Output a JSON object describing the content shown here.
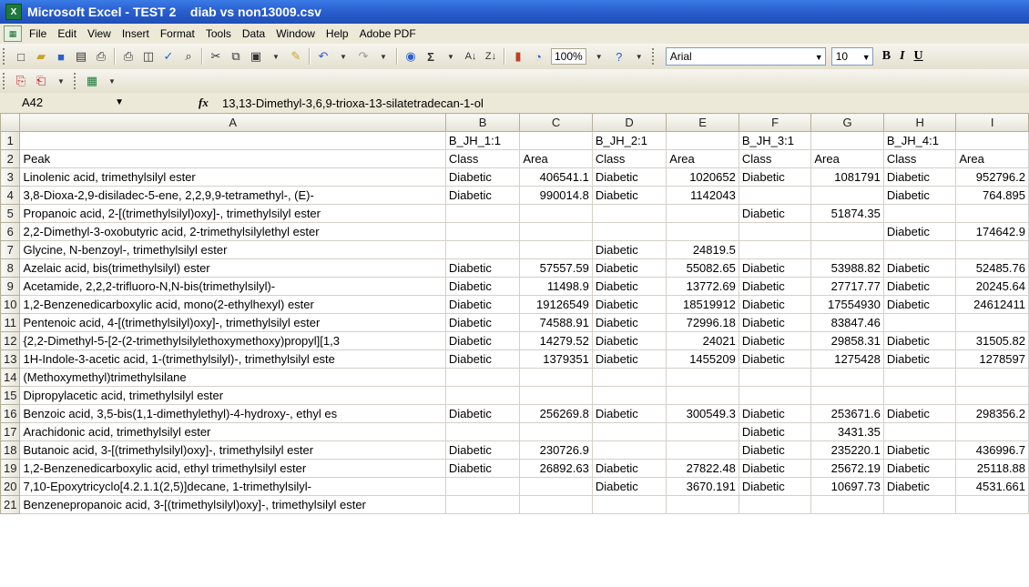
{
  "window": {
    "title": "Microsoft Excel - TEST 2    diab vs non13009.csv",
    "app_icon": "excel-icon"
  },
  "menu": [
    "File",
    "Edit",
    "View",
    "Insert",
    "Format",
    "Tools",
    "Data",
    "Window",
    "Help",
    "Adobe PDF"
  ],
  "toolbar": {
    "zoom": "100%",
    "font": "Arial",
    "size": "10",
    "bold": "B",
    "italic": "I",
    "underline": "U"
  },
  "formula_bar": {
    "name_box": "A42",
    "fx": "fx",
    "formula": "13,13-Dimethyl-3,6,9-trioxa-13-silatetradecan-1-ol"
  },
  "columns": [
    "A",
    "B",
    "C",
    "D",
    "E",
    "F",
    "G",
    "H",
    "I"
  ],
  "rows": [
    {
      "n": "1",
      "cells": [
        "",
        "B_JH_1:1",
        "",
        "B_JH_2:1",
        "",
        "B_JH_3:1",
        "",
        "B_JH_4:1",
        ""
      ]
    },
    {
      "n": "2",
      "cells": [
        "Peak",
        "Class",
        "Area",
        "Class",
        "Area",
        "Class",
        "Area",
        "Class",
        "Area"
      ]
    },
    {
      "n": "3",
      "cells": [
        "Linolenic acid, trimethylsilyl ester",
        "Diabetic",
        "406541.1",
        "Diabetic",
        "1020652",
        "Diabetic",
        "1081791",
        "Diabetic",
        "952796.2"
      ]
    },
    {
      "n": "4",
      "cells": [
        "3,8-Dioxa-2,9-disiladec-5-ene, 2,2,9,9-tetramethyl-, (E)-",
        "Diabetic",
        "990014.8",
        "Diabetic",
        "1142043",
        "",
        "",
        "Diabetic",
        "764.895"
      ]
    },
    {
      "n": "5",
      "cells": [
        "Propanoic acid, 2-[(trimethylsilyl)oxy]-, trimethylsilyl ester",
        "",
        "",
        "",
        "",
        "Diabetic",
        "51874.35",
        "",
        ""
      ]
    },
    {
      "n": "6",
      "cells": [
        "2,2-Dimethyl-3-oxobutyric acid, 2-trimethylsilylethyl ester",
        "",
        "",
        "",
        "",
        "",
        "",
        "Diabetic",
        "174642.9"
      ]
    },
    {
      "n": "7",
      "cells": [
        "Glycine, N-benzoyl-, trimethylsilyl ester",
        "",
        "",
        "Diabetic",
        "24819.5",
        "",
        "",
        "",
        ""
      ]
    },
    {
      "n": "8",
      "cells": [
        "Azelaic acid, bis(trimethylsilyl) ester",
        "Diabetic",
        "57557.59",
        "Diabetic",
        "55082.65",
        "Diabetic",
        "53988.82",
        "Diabetic",
        "52485.76"
      ]
    },
    {
      "n": "9",
      "cells": [
        "Acetamide, 2,2,2-trifluoro-N,N-bis(trimethylsilyl)-",
        "Diabetic",
        "11498.9",
        "Diabetic",
        "13772.69",
        "Diabetic",
        "27717.77",
        "Diabetic",
        "20245.64"
      ]
    },
    {
      "n": "10",
      "cells": [
        "1,2-Benzenedicarboxylic acid, mono(2-ethylhexyl) ester",
        "Diabetic",
        "19126549",
        "Diabetic",
        "18519912",
        "Diabetic",
        "17554930",
        "Diabetic",
        "24612411"
      ]
    },
    {
      "n": "11",
      "cells": [
        "Pentenoic acid, 4-[(trimethylsilyl)oxy]-, trimethylsilyl ester",
        "Diabetic",
        "74588.91",
        "Diabetic",
        "72996.18",
        "Diabetic",
        "83847.46",
        "",
        ""
      ]
    },
    {
      "n": "12",
      "cells": [
        "{2,2-Dimethyl-5-[2-(2-trimethylsilylethoxymethoxy)propyl][1,3",
        "Diabetic",
        "14279.52",
        "Diabetic",
        "24021",
        "Diabetic",
        "29858.31",
        "Diabetic",
        "31505.82"
      ]
    },
    {
      "n": "13",
      "cells": [
        "1H-Indole-3-acetic acid, 1-(trimethylsilyl)-, trimethylsilyl este",
        "Diabetic",
        "1379351",
        "Diabetic",
        "1455209",
        "Diabetic",
        "1275428",
        "Diabetic",
        "1278597"
      ]
    },
    {
      "n": "14",
      "cells": [
        "(Methoxymethyl)trimethylsilane",
        "",
        "",
        "",
        "",
        "",
        "",
        "",
        ""
      ]
    },
    {
      "n": "15",
      "cells": [
        "Dipropylacetic acid, trimethylsilyl ester",
        "",
        "",
        "",
        "",
        "",
        "",
        "",
        ""
      ]
    },
    {
      "n": "16",
      "cells": [
        "Benzoic acid, 3,5-bis(1,1-dimethylethyl)-4-hydroxy-, ethyl es",
        "Diabetic",
        "256269.8",
        "Diabetic",
        "300549.3",
        "Diabetic",
        "253671.6",
        "Diabetic",
        "298356.2"
      ]
    },
    {
      "n": "17",
      "cells": [
        "Arachidonic acid, trimethylsilyl ester",
        "",
        "",
        "",
        "",
        "Diabetic",
        "3431.35",
        "",
        ""
      ]
    },
    {
      "n": "18",
      "cells": [
        "Butanoic acid, 3-[(trimethylsilyl)oxy]-, trimethylsilyl ester",
        "Diabetic",
        "230726.9",
        "",
        "",
        "Diabetic",
        "235220.1",
        "Diabetic",
        "436996.7"
      ]
    },
    {
      "n": "19",
      "cells": [
        "1,2-Benzenedicarboxylic acid, ethyl trimethylsilyl ester",
        "Diabetic",
        "26892.63",
        "Diabetic",
        "27822.48",
        "Diabetic",
        "25672.19",
        "Diabetic",
        "25118.88"
      ]
    },
    {
      "n": "20",
      "cells": [
        "7,10-Epoxytricyclo[4.2.1.1(2,5)]decane, 1-trimethylsilyl-",
        "",
        "",
        "Diabetic",
        "3670.191",
        "Diabetic",
        "10697.73",
        "Diabetic",
        "4531.661"
      ]
    },
    {
      "n": "21",
      "cells": [
        "Benzenepropanoic acid, 3-[(trimethylsilyl)oxy]-, trimethylsilyl ester",
        "",
        "",
        "",
        "",
        "",
        "",
        "",
        ""
      ]
    }
  ]
}
